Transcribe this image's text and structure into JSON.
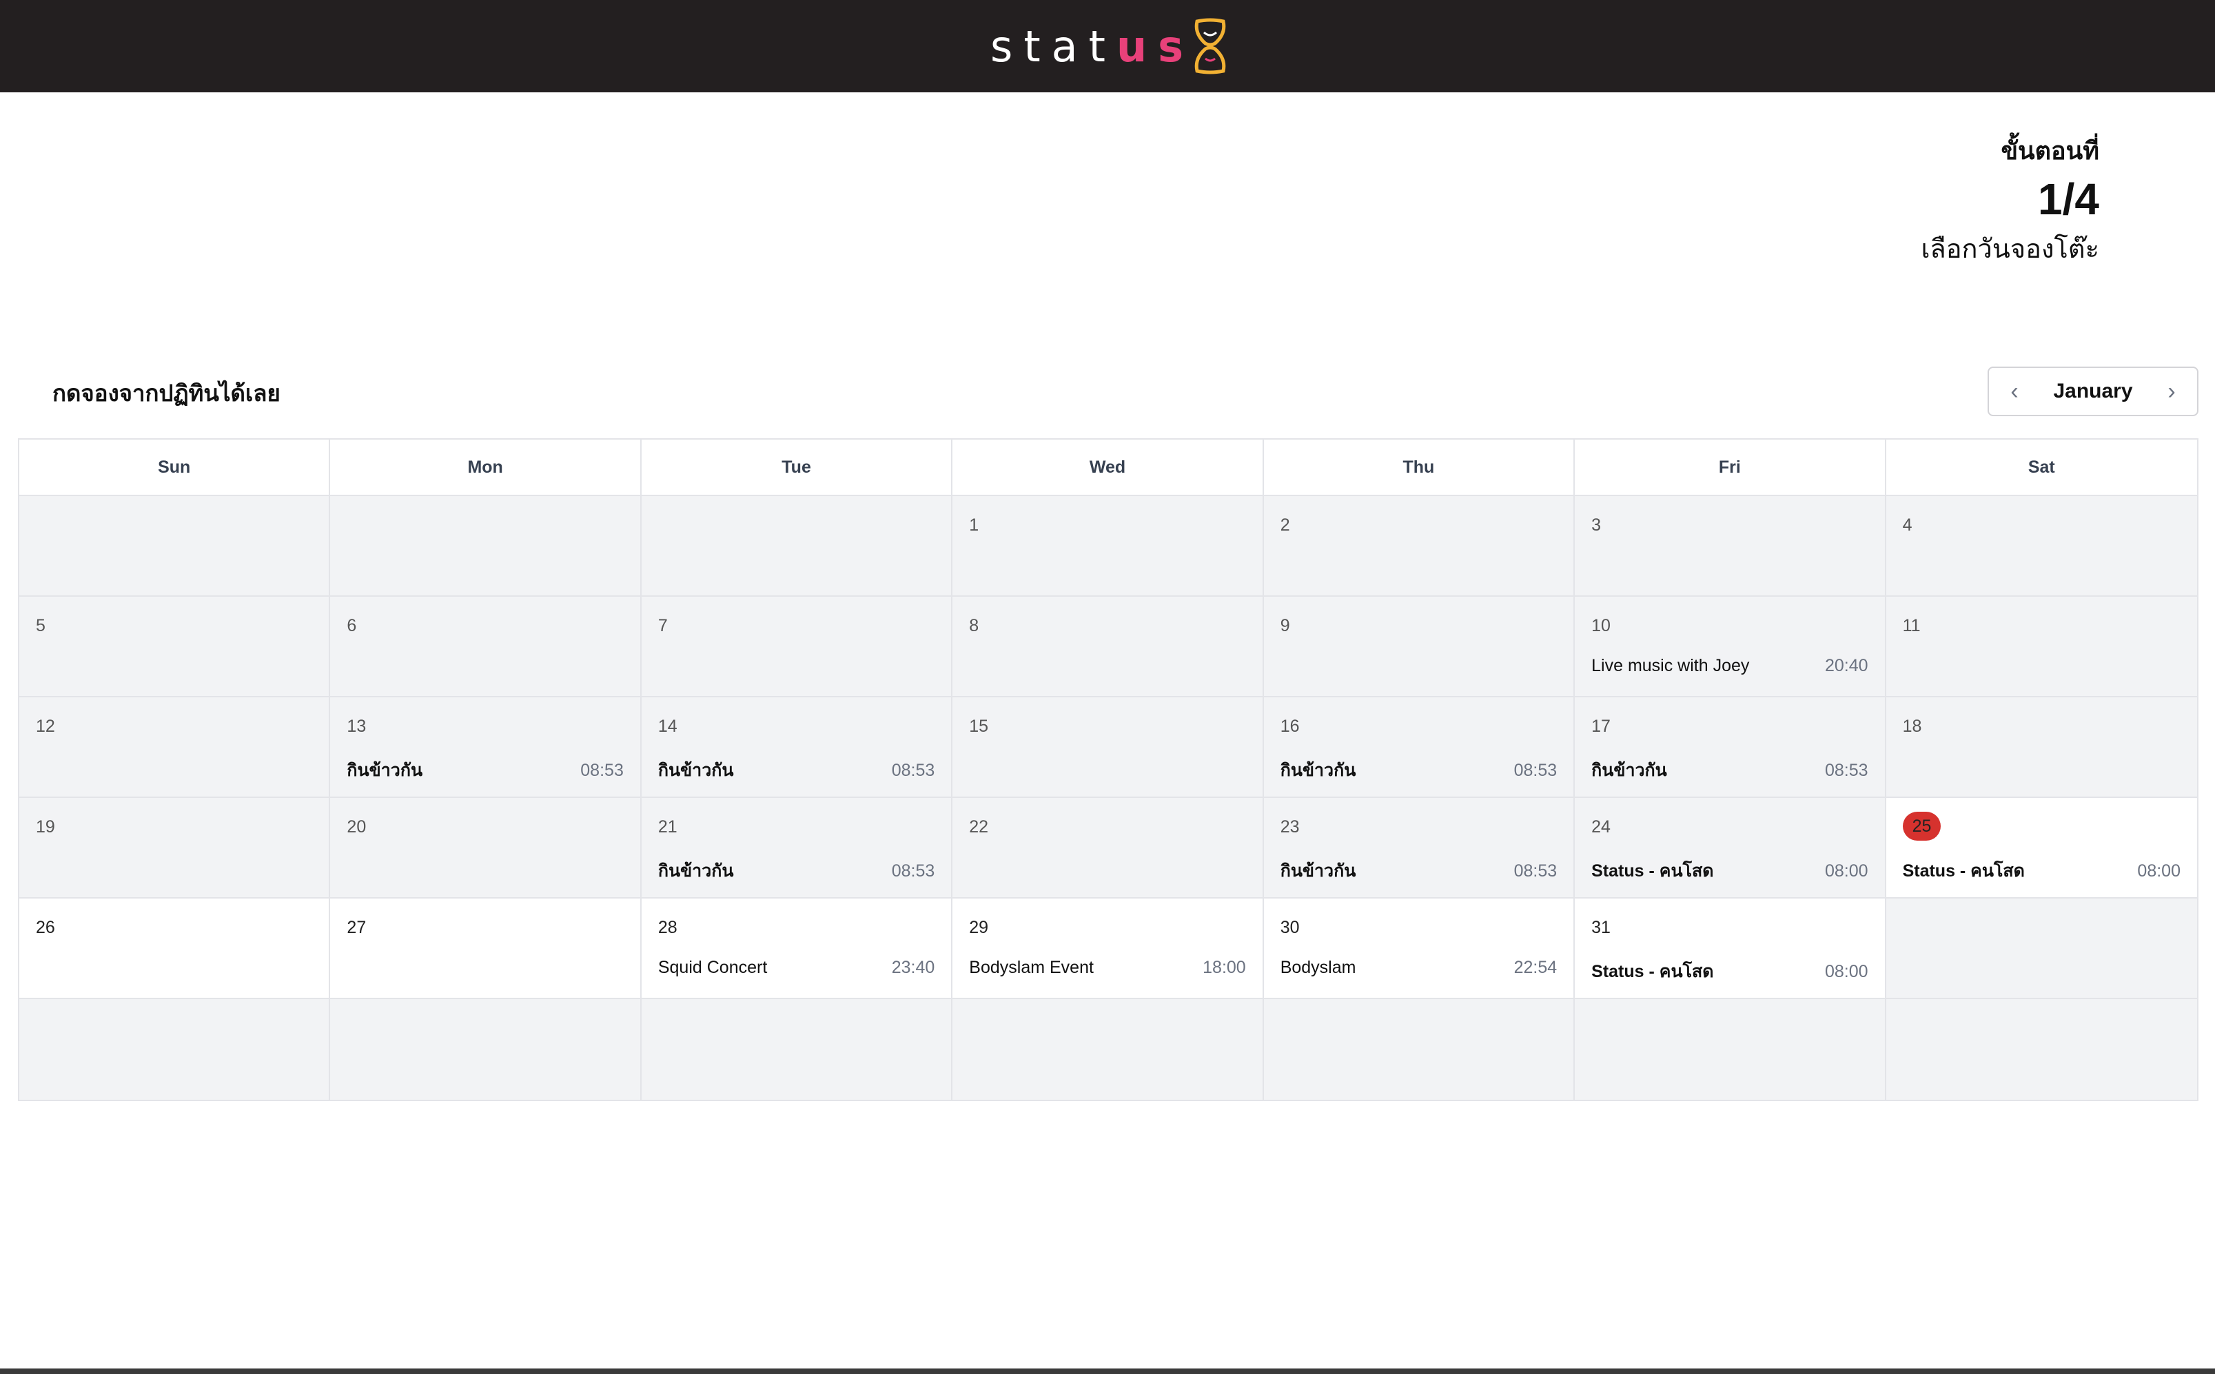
{
  "header": {
    "logo_plain": "stat",
    "logo_accent": "us"
  },
  "step": {
    "label": "ขั้นตอนที่",
    "count": "1/4",
    "description": "เลือกวันจองโต๊ะ"
  },
  "instruction": "กดจองจากปฏิทินได้เลย",
  "month_nav": {
    "month": "January",
    "prev_icon": "chevron-left-icon",
    "next_icon": "chevron-right-icon"
  },
  "weekdays": [
    "Sun",
    "Mon",
    "Tue",
    "Wed",
    "Thu",
    "Fri",
    "Sat"
  ],
  "weeks": [
    [
      {
        "day": "",
        "white": false,
        "event": null
      },
      {
        "day": "",
        "white": false,
        "event": null
      },
      {
        "day": "",
        "white": false,
        "event": null
      },
      {
        "day": "1",
        "white": false,
        "event": null
      },
      {
        "day": "2",
        "white": false,
        "event": null
      },
      {
        "day": "3",
        "white": false,
        "event": null
      },
      {
        "day": "4",
        "white": false,
        "event": null
      }
    ],
    [
      {
        "day": "5",
        "white": false,
        "event": null
      },
      {
        "day": "6",
        "white": false,
        "event": null
      },
      {
        "day": "7",
        "white": false,
        "event": null
      },
      {
        "day": "8",
        "white": false,
        "event": null
      },
      {
        "day": "9",
        "white": false,
        "event": null
      },
      {
        "day": "10",
        "white": false,
        "event": {
          "name": "Live music with Joey",
          "time": "20:40",
          "bold": false
        }
      },
      {
        "day": "11",
        "white": false,
        "event": null
      }
    ],
    [
      {
        "day": "12",
        "white": false,
        "event": null
      },
      {
        "day": "13",
        "white": false,
        "event": {
          "name": "กินข้าวกัน",
          "time": "08:53",
          "bold": true
        }
      },
      {
        "day": "14",
        "white": false,
        "event": {
          "name": "กินข้าวกัน",
          "time": "08:53",
          "bold": true
        }
      },
      {
        "day": "15",
        "white": false,
        "event": null
      },
      {
        "day": "16",
        "white": false,
        "event": {
          "name": "กินข้าวกัน",
          "time": "08:53",
          "bold": true
        }
      },
      {
        "day": "17",
        "white": false,
        "event": {
          "name": "กินข้าวกัน",
          "time": "08:53",
          "bold": true
        }
      },
      {
        "day": "18",
        "white": false,
        "event": null
      }
    ],
    [
      {
        "day": "19",
        "white": false,
        "event": null
      },
      {
        "day": "20",
        "white": false,
        "event": null
      },
      {
        "day": "21",
        "white": false,
        "event": {
          "name": "กินข้าวกัน",
          "time": "08:53",
          "bold": true
        }
      },
      {
        "day": "22",
        "white": false,
        "event": null
      },
      {
        "day": "23",
        "white": false,
        "event": {
          "name": "กินข้าวกัน",
          "time": "08:53",
          "bold": true
        }
      },
      {
        "day": "24",
        "white": false,
        "event": {
          "name": "Status - คนโสด",
          "time": "08:00",
          "bold": true
        }
      },
      {
        "day": "25",
        "white": true,
        "today": true,
        "event": {
          "name": "Status - คนโสด",
          "time": "08:00",
          "bold": true
        }
      }
    ],
    [
      {
        "day": "26",
        "white": true,
        "event": null
      },
      {
        "day": "27",
        "white": true,
        "event": null
      },
      {
        "day": "28",
        "white": true,
        "event": {
          "name": "Squid Concert",
          "time": "23:40",
          "bold": false
        }
      },
      {
        "day": "29",
        "white": true,
        "event": {
          "name": "Bodyslam Event",
          "time": "18:00",
          "bold": false
        }
      },
      {
        "day": "30",
        "white": true,
        "event": {
          "name": "Bodyslam",
          "time": "22:54",
          "bold": false
        }
      },
      {
        "day": "31",
        "white": true,
        "event": {
          "name": "Status - คนโสด",
          "time": "08:00",
          "bold": true
        }
      },
      {
        "day": "",
        "white": false,
        "event": null
      }
    ],
    [
      {
        "day": "",
        "white": false,
        "event": null
      },
      {
        "day": "",
        "white": false,
        "event": null
      },
      {
        "day": "",
        "white": false,
        "event": null
      },
      {
        "day": "",
        "white": false,
        "event": null
      },
      {
        "day": "",
        "white": false,
        "event": null
      },
      {
        "day": "",
        "white": false,
        "event": null
      },
      {
        "day": "",
        "white": false,
        "event": null
      }
    ]
  ],
  "colors": {
    "topbar": "#231f20",
    "accent": "#e8417a",
    "logo_icon": "#f2b133",
    "today_badge": "#d6322e"
  }
}
